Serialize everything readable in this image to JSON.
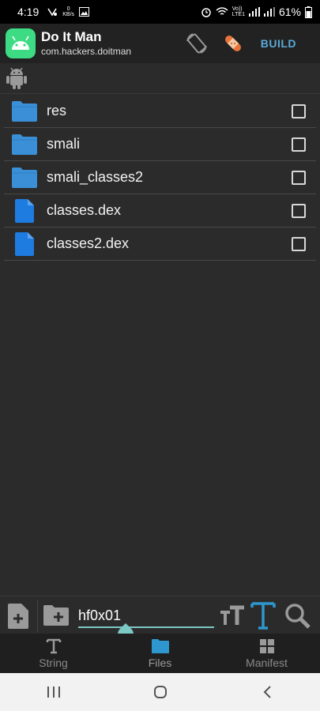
{
  "status_bar": {
    "time": "4:19",
    "net_speed": "0\nKB/s",
    "volte": "Vo)) LTE1",
    "battery": "61%"
  },
  "app": {
    "title": "Do It Man",
    "package": "com.hackers.doitman",
    "build_label": "BUILD"
  },
  "files": [
    {
      "name": "res",
      "type": "folder"
    },
    {
      "name": "smali",
      "type": "folder"
    },
    {
      "name": "smali_classes2",
      "type": "folder"
    },
    {
      "name": "classes.dex",
      "type": "file"
    },
    {
      "name": "classes2.dex",
      "type": "file"
    }
  ],
  "input": {
    "value": "hf0x01"
  },
  "tabs": [
    {
      "label": "String",
      "icon": "text-t-icon"
    },
    {
      "label": "Files",
      "icon": "folder-icon",
      "active": true
    },
    {
      "label": "Manifest",
      "icon": "grid-icon"
    }
  ],
  "colors": {
    "accent": "#5aa9d6",
    "folder": "#3a8fd6",
    "file": "#1e7be0",
    "input_underline": "#7cc8c4"
  }
}
